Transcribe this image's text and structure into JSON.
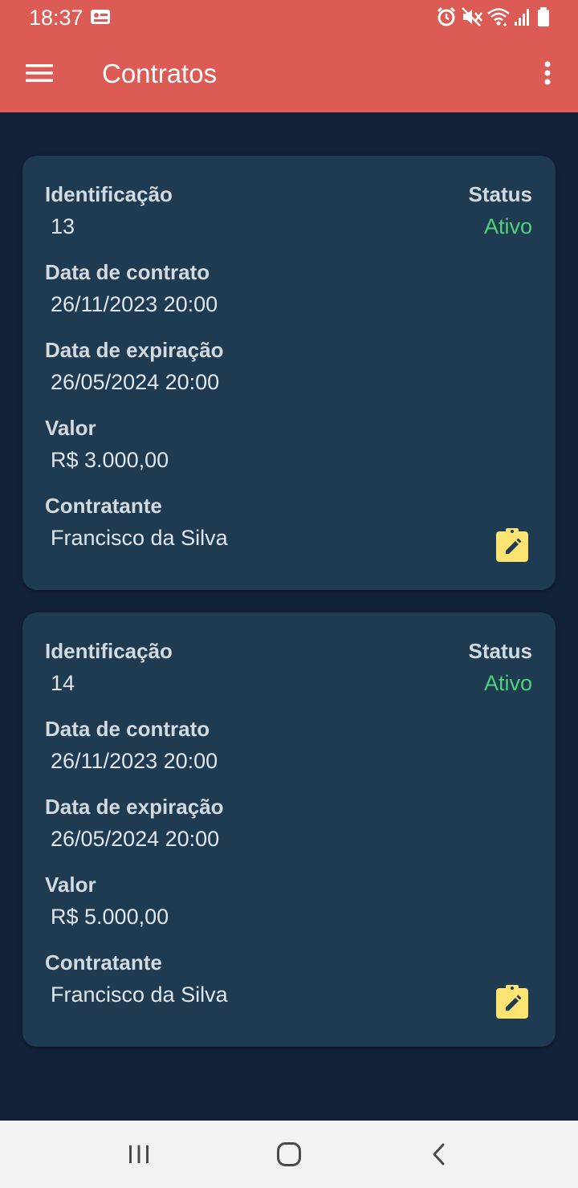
{
  "status_bar": {
    "time": "18:37"
  },
  "app_bar": {
    "title": "Contratos",
    "menu_icon": "menu-icon",
    "more_icon": "more-vert-icon"
  },
  "labels": {
    "identificacao": "Identificação",
    "status": "Status",
    "data_contrato": "Data de contrato",
    "data_expiracao": "Data de expiração",
    "valor": "Valor",
    "contratante": "Contratante"
  },
  "contracts": [
    {
      "id": "13",
      "status": "Ativo",
      "data_contrato": "26/11/2023 20:00",
      "data_expiracao": "26/05/2024 20:00",
      "valor": "R$ 3.000,00",
      "contratante": "Francisco da Silva"
    },
    {
      "id": "14",
      "status": "Ativo",
      "data_contrato": "26/11/2023 20:00",
      "data_expiracao": "26/05/2024 20:00",
      "valor": "R$ 5.000,00",
      "contratante": "Francisco da Silva"
    }
  ],
  "colors": {
    "header": "#dc5b54",
    "background": "#12213a",
    "card": "#1f3b51",
    "status_active": "#4cd37a",
    "edit_icon": "#fde372"
  }
}
